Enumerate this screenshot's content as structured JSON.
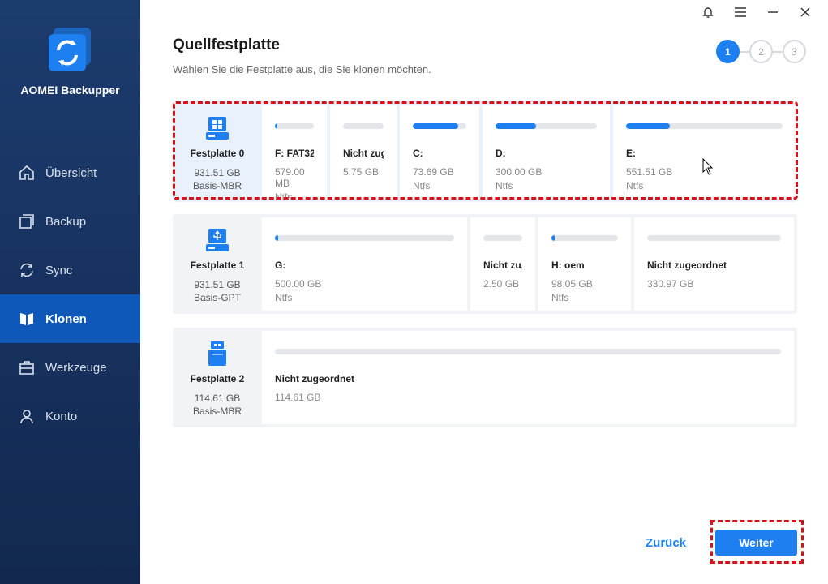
{
  "app": {
    "name": "AOMEI Backupper"
  },
  "window": {
    "controls": [
      "notification-icon",
      "menu-icon",
      "minimize-icon",
      "close-icon"
    ]
  },
  "sidebar": {
    "items": [
      {
        "label": "Übersicht",
        "icon": "home-icon",
        "active": false
      },
      {
        "label": "Backup",
        "icon": "backup-icon",
        "active": false
      },
      {
        "label": "Sync",
        "icon": "sync-icon",
        "active": false
      },
      {
        "label": "Klonen",
        "icon": "clone-icon",
        "active": true
      },
      {
        "label": "Werkzeuge",
        "icon": "toolbox-icon",
        "active": false
      },
      {
        "label": "Konto",
        "icon": "user-icon",
        "active": false
      }
    ]
  },
  "page": {
    "title": "Quellfestplatte",
    "subtitle": "Wählen Sie die Festplatte aus, die Sie klonen möchten."
  },
  "steps": [
    "1",
    "2",
    "3"
  ],
  "disks": [
    {
      "name": "Festplatte 0",
      "size": "931.51 GB",
      "type": "Basis-MBR",
      "icon": "windows-disk-icon",
      "selected": true,
      "partitions": [
        {
          "label": "F: FAT32",
          "size": "579.00 MB",
          "fs": "Ntfs",
          "used": 0.03
        },
        {
          "label": "Nicht zug...",
          "size": "5.75 GB",
          "fs": "",
          "used": 0
        },
        {
          "label": "C:",
          "size": "73.69 GB",
          "fs": "Ntfs",
          "used": 0.85
        },
        {
          "label": "D:",
          "size": "300.00 GB",
          "fs": "Ntfs",
          "used": 0.4
        },
        {
          "label": "E:",
          "size": "551.51 GB",
          "fs": "Ntfs",
          "used": 0.28
        }
      ]
    },
    {
      "name": "Festplatte 1",
      "size": "931.51 GB",
      "type": "Basis-GPT",
      "icon": "usb-disk-icon",
      "selected": false,
      "partitions": [
        {
          "label": "G:",
          "size": "500.00 GB",
          "fs": "Ntfs",
          "used": 0.01
        },
        {
          "label": "Nicht zu...",
          "size": "2.50 GB",
          "fs": "",
          "used": 0
        },
        {
          "label": "H: oem",
          "size": "98.05 GB",
          "fs": "Ntfs",
          "used": 0.04
        },
        {
          "label": "Nicht zugeordnet",
          "size": "330.97 GB",
          "fs": "",
          "used": 0
        }
      ]
    },
    {
      "name": "Festplatte 2",
      "size": "114.61 GB",
      "type": "Basis-MBR",
      "icon": "usb-stick-icon",
      "selected": false,
      "partitions": [
        {
          "label": "Nicht zugeordnet",
          "size": "114.61 GB",
          "fs": "",
          "used": 0
        }
      ]
    }
  ],
  "buttons": {
    "back": "Zurück",
    "next": "Weiter"
  },
  "colors": {
    "accent": "#1d7ff0",
    "sidebar": "#1c3c6e",
    "highlight": "#d8121a"
  }
}
